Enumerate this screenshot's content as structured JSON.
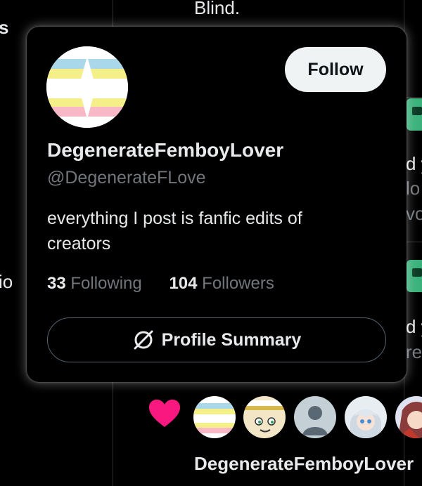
{
  "background": {
    "top_text": "Blind.",
    "left_fragment_top": "s",
    "left_fragment_bottom": "io",
    "right_fragments": [
      "d y",
      "lo",
      "vo",
      "d y",
      "re"
    ]
  },
  "card": {
    "follow_label": "Follow",
    "display_name": "DegenerateFemboyLover",
    "handle": "@DegenerateFLove",
    "bio": "everything I post is fanfic edits of creators",
    "following_count": "33",
    "following_label": "Following",
    "followers_count": "104",
    "followers_label": "Followers",
    "summary_label": "Profile Summary"
  },
  "likes": {
    "liked_by_name": "DegenerateFemboyLover"
  },
  "colors": {
    "background": "#000000",
    "text": "#e7e9ea",
    "muted": "#71767b",
    "follow_button": "#eff3f4",
    "heart": "#f91880"
  }
}
